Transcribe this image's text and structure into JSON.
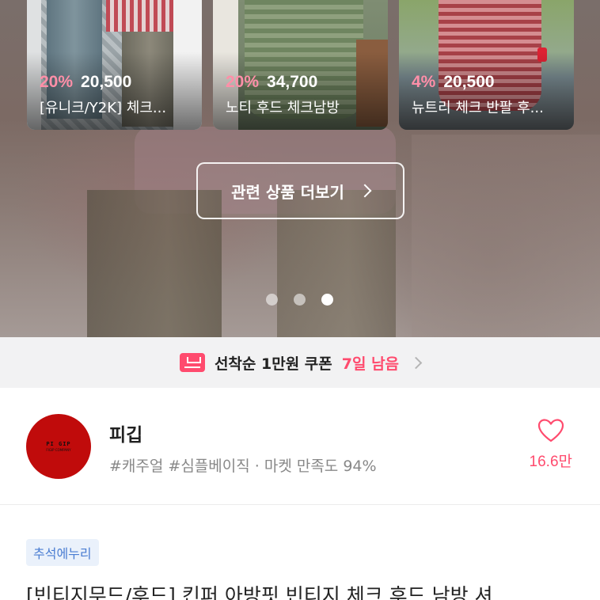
{
  "related_products": [
    {
      "discount": "20%",
      "price": "20,500",
      "name": "[유니크/Y2K] 체크..."
    },
    {
      "discount": "20%",
      "price": "34,700",
      "name": "노티 후드 체크남방"
    },
    {
      "discount": "4%",
      "price": "20,500",
      "name": "뉴트리 체크 반팔 후..."
    }
  ],
  "more_button": {
    "label": "관련 상품 더보기"
  },
  "carousel": {
    "total": 3,
    "active_index": 2
  },
  "coupon": {
    "text": "선착순 1만원 쿠폰",
    "days_left": "7일 남음",
    "icon": "coupon-download-icon"
  },
  "shop": {
    "name": "피깁",
    "logo_text": "PI GIP",
    "logo_subtext": "FIGIP COMPANY",
    "tags": "#캐주얼 #심플베이직 · 마켓 만족도 94%",
    "like_count": "16.6만",
    "like_icon": "heart-outline-icon"
  },
  "product": {
    "badge": "추석에누리",
    "title": "[빈티지무드/후드] 킨퍼 아방핏 빈티지 체크 후드 남방 셔"
  },
  "colors": {
    "accent": "#ff4b6e",
    "badge_text": "#4a7dd2",
    "badge_bg": "#eaf1fb"
  }
}
